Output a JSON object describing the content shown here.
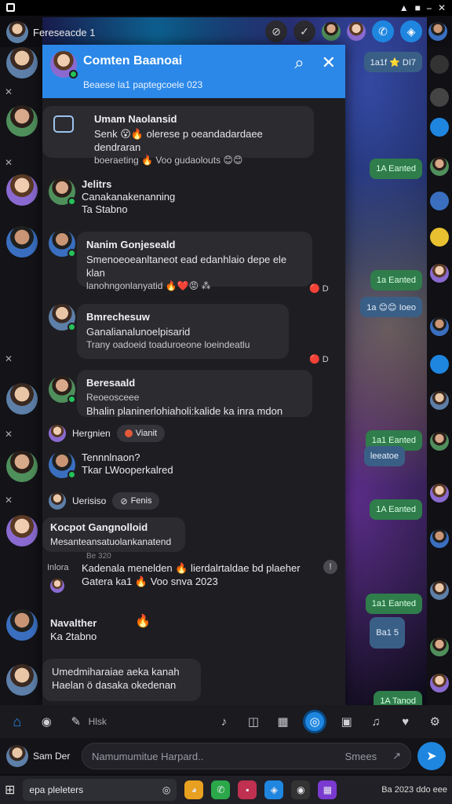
{
  "status_bar": {
    "icons": [
      "wifi-icon",
      "battery-icon",
      "minimize-icon",
      "close-icon"
    ],
    "glyphs": [
      "▲",
      "■",
      "⎯",
      "✕"
    ]
  },
  "top": {
    "title": "Fereseacde 1",
    "icons": [
      "slash-icon",
      "check-icon"
    ]
  },
  "header": {
    "title": "Comten Baanoai",
    "subtitle": "Beaese la1 paptegcoele 023",
    "search_icon": "search-icon",
    "close_icon": "close-icon"
  },
  "messages": [
    {
      "id": "m1",
      "name": "Umam Naolansid",
      "text": "Senk 😮🔥 olerese p oeandadardaee dendraran",
      "meta": "boeraeting 🔥 Voo gudaolouts 😊😊"
    },
    {
      "id": "m2",
      "name": "Jelitrs",
      "text": "Canakanakenanning",
      "meta": "Ta Stabno"
    },
    {
      "id": "m3",
      "name": "Nanim Gonjeseald",
      "text": "Smenoeoeanltaneot ead edanhlaio depe ele klan",
      "meta": "lanohngonlanyatid 🔥❤️😡 ⁂",
      "reactions": "🔴 D"
    },
    {
      "id": "m4",
      "name": "Bmrechesuw",
      "text": "Ganalianalunoelpisarid",
      "meta": "Trany oadoeid toaduroeone loeindeatlu",
      "reactions": "🔴 D"
    },
    {
      "id": "m5",
      "name": "Beresaald",
      "text": "Reoeosceee",
      "meta": "Bhalin planinerlohiaholi:kalide ka inra mdon"
    },
    {
      "id": "m6",
      "name": "Hergnien",
      "chip": "Vianit"
    },
    {
      "id": "m7",
      "name": "Tennnlnaon?",
      "text": "Tkar LWooperkalred"
    },
    {
      "id": "m8",
      "name": "Uerisiso",
      "chip": "Fenis"
    },
    {
      "id": "m9",
      "name": "Kocpot Gangnolloid",
      "text": "Mesanteansatuolankanatend",
      "sub": "Be 320",
      "label": "Inlora",
      "detail": "Kadenala menelden 🔥 lierdalrtaldae bd plaeher",
      "detail_meta": "Gatera ka1 🔥 Voo snva 2023"
    },
    {
      "id": "m10",
      "name": "Navalther",
      "meta": "Ka 2tabno"
    },
    {
      "id": "m11",
      "name": "Umedmiharaiae aeka kanah",
      "text": "Haelan ö dasaka okedenan"
    }
  ],
  "side_bubbles": [
    "1a1f ⭐ DI7",
    "1A Eanted",
    "1a Eanted",
    "1a 😊😊 Ioeo",
    "1a1 Eanted",
    "leeatoe",
    "1A Eanted",
    "1a1 Eanted",
    "Ba1 5",
    "1A Tanod"
  ],
  "toolbar": {
    "search_label": "Hlsk",
    "icons": [
      "home-icon",
      "location-icon",
      "pen-icon",
      "mic-icon",
      "camera-icon",
      "gallery-icon",
      "chat-icon",
      "sticker-icon",
      "audio-icon",
      "heart-icon",
      "share-icon"
    ]
  },
  "composer": {
    "me": "Sam Der",
    "placeholder": "Namumumitue Harpard..",
    "hint": "Smees"
  },
  "taskbar": {
    "search": "epa pleleters",
    "time": "Ba 2023 ddo eee"
  }
}
